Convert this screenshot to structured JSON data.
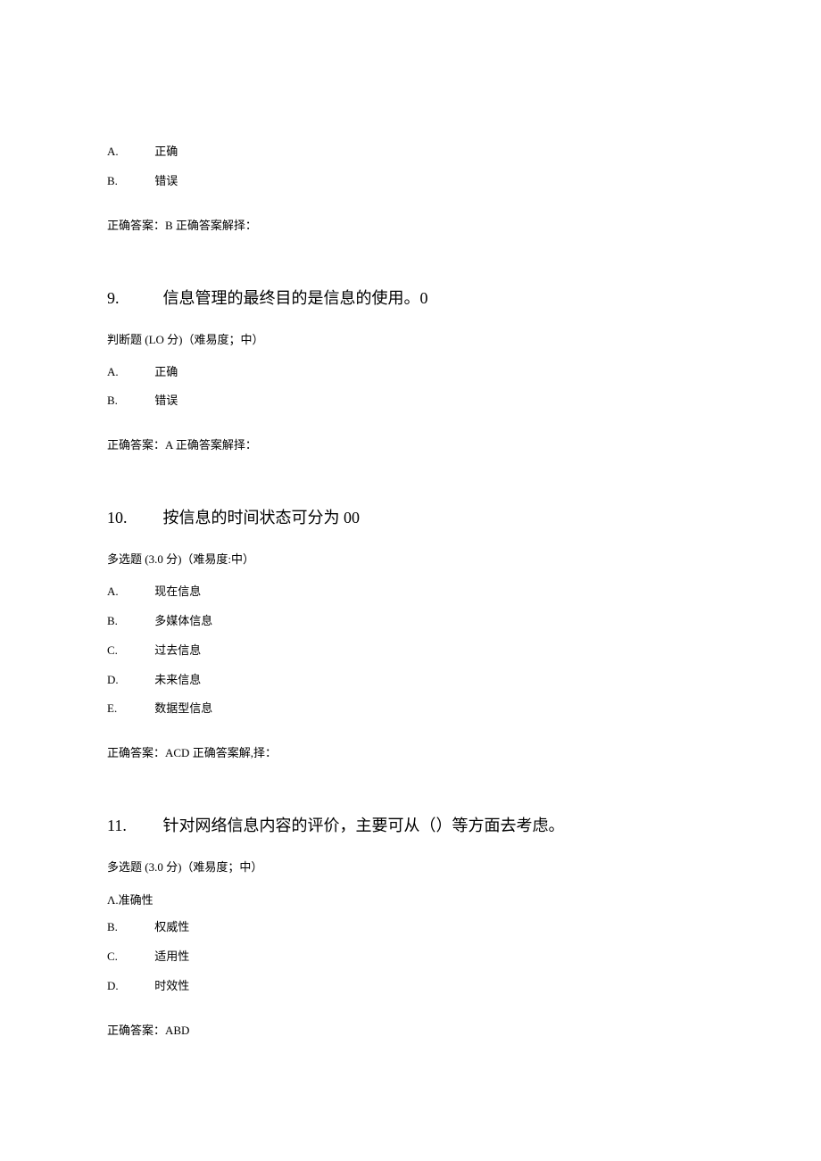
{
  "q8_tail": {
    "options": [
      {
        "letter": "A.",
        "text": "正确"
      },
      {
        "letter": "B.",
        "text": "错误"
      }
    ],
    "answer": "正确答案：B 正确答案解择："
  },
  "q9": {
    "number": "9.",
    "title": "信息管理的最终目的是信息的使用。0",
    "meta": "判断题 (LO 分)（难易度；中）",
    "options": [
      {
        "letter": "A.",
        "text": "正确"
      },
      {
        "letter": "B.",
        "text": "错误"
      }
    ],
    "answer": "正确答案：A 正确答案解择："
  },
  "q10": {
    "number": "10.",
    "title": "按信息的时间状态可分为 00",
    "meta": "多选题 (3.0 分)（难易度:中）",
    "options": [
      {
        "letter": "A.",
        "text": "现在信息"
      },
      {
        "letter": "B.",
        "text": "多媒体信息"
      },
      {
        "letter": "C.",
        "text": "过去信息"
      },
      {
        "letter": "D.",
        "text": "未来信息"
      },
      {
        "letter": "E.",
        "text": "数据型信息"
      }
    ],
    "answer": "正确答案：ACD 正确答案解,择："
  },
  "q11": {
    "number": "11.",
    "title": "针对网络信息内容的评价，主要可从（）等方面去考虑。",
    "meta": "多选题 (3.0 分)（难易度；中）",
    "option_a_plain": "Λ.准确性",
    "options": [
      {
        "letter": "B.",
        "text": "权威性"
      },
      {
        "letter": "C.",
        "text": "适用性"
      },
      {
        "letter": "D.",
        "text": "时效性"
      }
    ],
    "answer": "正确答案：ABD"
  }
}
